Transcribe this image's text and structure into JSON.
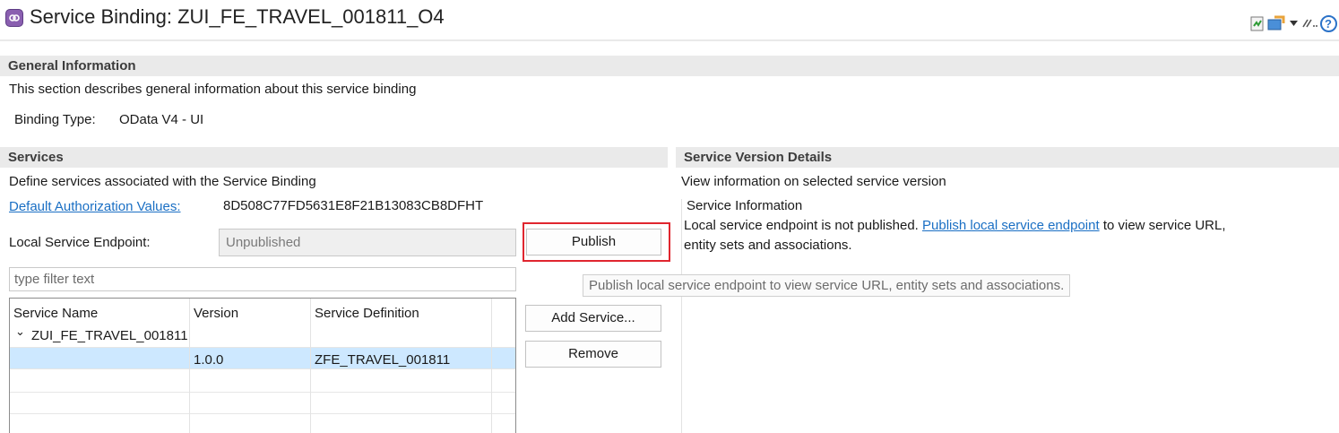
{
  "header": {
    "title": "Service Binding: ZUI_FE_TRAVEL_001811_O4",
    "toolbar_icons": [
      "refresh-page-icon",
      "share-export-icon",
      "dropdown-arrow-icon",
      "ellipsis-icon",
      "help-icon"
    ],
    "help_glyph": "?"
  },
  "general": {
    "header": "General Information",
    "description": "This section describes general information about this service binding",
    "binding_type_label": "Binding Type:",
    "binding_type_value": "OData V4 - UI"
  },
  "services": {
    "header": "Services",
    "description": "Define services associated with the Service Binding",
    "auth_link": "Default Authorization Values:",
    "auth_value": "8D508C77FD5631E8F21B13083CB8DFHT",
    "endpoint_label": "Local Service Endpoint:",
    "endpoint_value": "Unpublished",
    "publish_button": "Publish",
    "tooltip": "Publish local service endpoint to view service URL, entity sets and associations.",
    "filter_placeholder": "type filter text",
    "add_service_button": "Add Service...",
    "remove_button": "Remove",
    "table": {
      "columns": [
        "Service Name",
        "Version",
        "Service Definition"
      ],
      "group": "ZUI_FE_TRAVEL_001811",
      "expand_glyph": "⌄",
      "rows": [
        {
          "service_name": "",
          "version": "1.0.0",
          "definition": "ZFE_TRAVEL_001811"
        }
      ]
    }
  },
  "version_details": {
    "header": "Service Version Details",
    "description": "View information on selected service version",
    "info_title": "Service Information",
    "info_text_before": "Local service endpoint is not published.",
    "info_link": "Publish local service endpoint",
    "info_text_after": "to view service URL,",
    "info_text_line2": "entity sets and associations."
  },
  "colors": {
    "accent_link": "#1a6fc4",
    "selection": "#cde8ff",
    "highlight": "#e0262f",
    "section_header_bg": "#eaeaea"
  }
}
